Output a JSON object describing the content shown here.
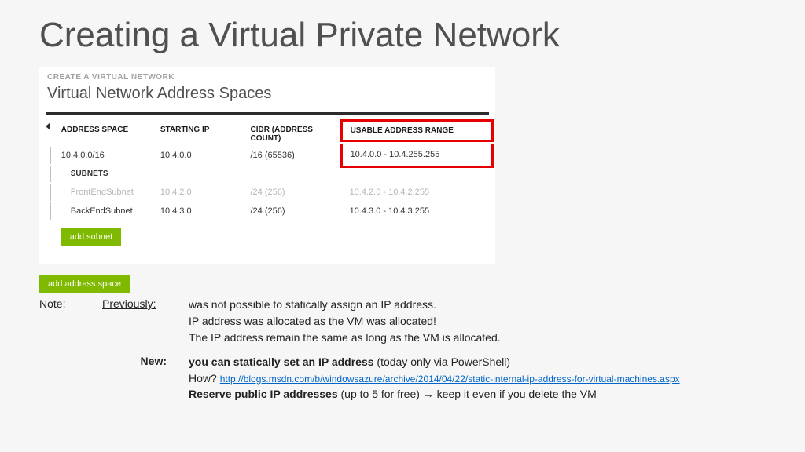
{
  "title": "Creating a Virtual Private Network",
  "eyebrow": "CREATE A VIRTUAL NETWORK",
  "subheading": "Virtual Network Address Spaces",
  "headers": {
    "addr": "ADDRESS SPACE",
    "start": "STARTING IP",
    "cidr": "CIDR (ADDRESS COUNT)",
    "range": "USABLE ADDRESS RANGE",
    "subnets": "SUBNETS"
  },
  "space": {
    "addr": "10.4.0.0/16",
    "start": "10.4.0.0",
    "cidr": "/16 (65536)",
    "range": "10.4.0.0 - 10.4.255.255"
  },
  "subnets": [
    {
      "name": "FrontEndSubnet",
      "start": "10.4.2.0",
      "cidr": "/24 (256)",
      "range": "10.4.2.0 - 10.4.2.255"
    },
    {
      "name": "BackEndSubnet",
      "start": "10.4.3.0",
      "cidr": "/24 (256)",
      "range": "10.4.3.0 - 10.4.3.255"
    }
  ],
  "buttons": {
    "addSubnet": "add subnet",
    "addSpace": "add address space"
  },
  "notes": {
    "label": "Note:",
    "prevLabel": "Previously:",
    "prev1": "was not possible to statically assign an IP address.",
    "prev2": "IP address was allocated as the VM was allocated!",
    "prev3": "The IP address remain the same as long as the VM is allocated.",
    "newLabel": "New:",
    "new1a": "you can statically set an IP address",
    "new1b": " (today only via PowerShell)",
    "new2a": "How? ",
    "new2link": "http://blogs.msdn.com/b/windowsazure/archive/2014/04/22/static-internal-ip-address-for-virtual-machines.aspx",
    "new3a": "Reserve public IP addresses",
    "new3b": " (up to 5 for free) ",
    "new3c": " keep it even if you delete the VM"
  }
}
